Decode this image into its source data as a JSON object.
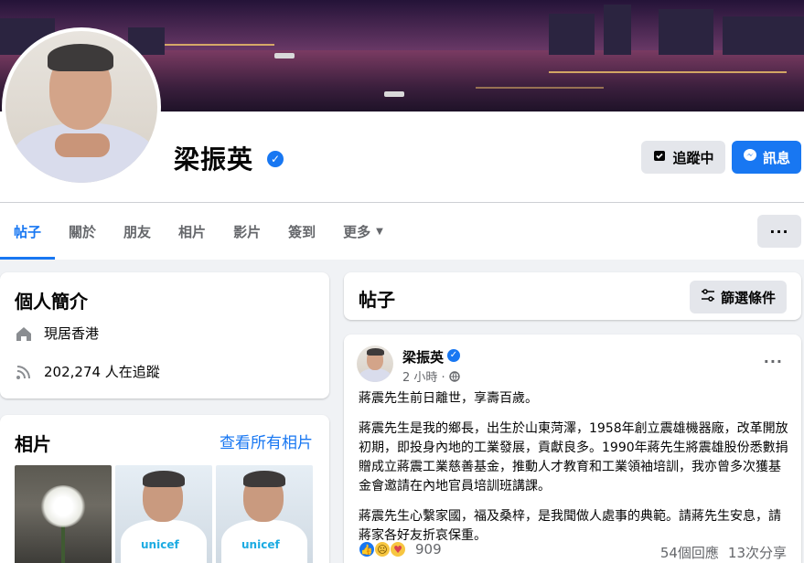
{
  "profile": {
    "name": "梁振英",
    "follow_label": "追蹤中",
    "message_label": "訊息"
  },
  "tabs": [
    {
      "label": "帖子"
    },
    {
      "label": "關於"
    },
    {
      "label": "朋友"
    },
    {
      "label": "相片"
    },
    {
      "label": "影片"
    },
    {
      "label": "簽到"
    },
    {
      "label": "更多"
    }
  ],
  "intro": {
    "title": "個人簡介",
    "lives_in": "現居香港",
    "followers": "202,274 人在追蹤"
  },
  "photos": {
    "title": "相片",
    "see_all": "查看所有相片",
    "unicef_text": "unicef"
  },
  "posts_section": {
    "title": "帖子",
    "filter_label": "篩選條件"
  },
  "post": {
    "author": "梁振英",
    "time": "2 小時",
    "paragraphs": [
      "蔣震先生前日離世，享壽百歲。",
      "蔣震先生是我的鄉長，出生於山東菏澤，1958年創立震雄機器廠，改革開放初期，即投身內地的工業發展，貢獻良多。1990年蔣先生將震雄股份悉數捐贈成立蔣震工業慈善基金，推動人才教育和工業領袖培訓，我亦曾多次獲基金會邀請在內地官員培訓班講課。",
      "蔣震先生心繫家國，福及桑梓，是我聞做人處事的典範。請蔣先生安息，請蔣家各好友折哀保重。"
    ],
    "reaction_count": "909",
    "comments": "54個回應",
    "shares": "13次分享"
  },
  "colors": {
    "accent": "#1877f2",
    "page_bg": "#f0f2f5"
  }
}
